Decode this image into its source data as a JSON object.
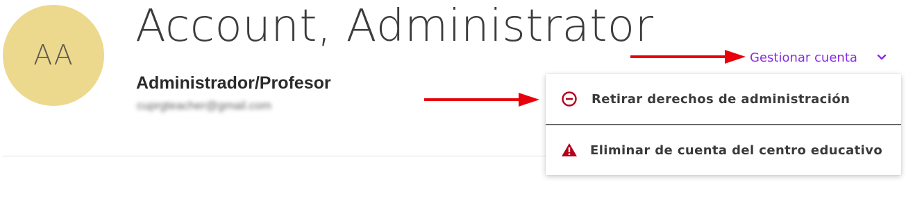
{
  "profile": {
    "initials": "AA",
    "name": "Account, Administrator",
    "role": "Administrador/Profesor",
    "email": "cuprgteacher@gmail.com"
  },
  "manage": {
    "label": "Gestionar cuenta",
    "icon": "chevron-down-icon"
  },
  "menu": {
    "items": [
      {
        "label": "Retirar derechos de administración",
        "icon": "minus-circle-icon"
      },
      {
        "label": "Eliminar de cuenta del centro educativo",
        "icon": "warning-triangle-icon"
      }
    ]
  },
  "colors": {
    "avatar_bg": "#ecd98d",
    "accent": "#8a2be2",
    "danger": "#b3001b",
    "annotation_arrow": "#e8000b"
  }
}
